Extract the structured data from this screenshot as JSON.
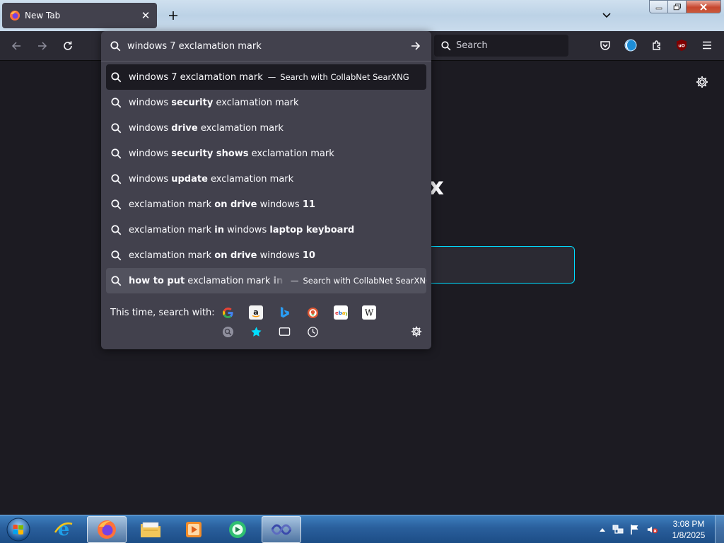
{
  "tab": {
    "title": "New Tab",
    "close": "✕",
    "icon": "firefox-icon"
  },
  "tabstrip": {
    "newtab_label": "+",
    "tablist_icon": "chevron-down-icon"
  },
  "window_controls": {
    "minimize": "minimize-icon",
    "maximize": "maximize-icon",
    "close": "close-icon"
  },
  "urlbar": {
    "value": "windows 7 exclamation mark",
    "results": [
      {
        "parts": [
          {
            "t": "windows 7 exclamation mark",
            "b": false
          }
        ],
        "action": "Search with CollabNet SearXNG",
        "state": "selected"
      },
      {
        "parts": [
          {
            "t": "windows ",
            "b": false
          },
          {
            "t": "security",
            "b": true
          },
          {
            "t": " exclamation mark",
            "b": false
          }
        ]
      },
      {
        "parts": [
          {
            "t": "windows ",
            "b": false
          },
          {
            "t": "drive",
            "b": true
          },
          {
            "t": " exclamation mark",
            "b": false
          }
        ]
      },
      {
        "parts": [
          {
            "t": "windows ",
            "b": false
          },
          {
            "t": "security shows",
            "b": true
          },
          {
            "t": " exclamation mark",
            "b": false
          }
        ]
      },
      {
        "parts": [
          {
            "t": "windows ",
            "b": false
          },
          {
            "t": "update",
            "b": true
          },
          {
            "t": " exclamation mark",
            "b": false
          }
        ]
      },
      {
        "parts": [
          {
            "t": "exclamation mark ",
            "b": false
          },
          {
            "t": "on drive",
            "b": true
          },
          {
            "t": " windows ",
            "b": false
          },
          {
            "t": "11",
            "b": true
          }
        ]
      },
      {
        "parts": [
          {
            "t": "exclamation mark ",
            "b": false
          },
          {
            "t": "in",
            "b": true
          },
          {
            "t": " windows ",
            "b": false
          },
          {
            "t": "laptop keyboard",
            "b": true
          }
        ]
      },
      {
        "parts": [
          {
            "t": "exclamation mark ",
            "b": false
          },
          {
            "t": "on drive",
            "b": true
          },
          {
            "t": " windows ",
            "b": false
          },
          {
            "t": "10",
            "b": true
          }
        ]
      },
      {
        "parts": [
          {
            "t": "how to put",
            "b": true
          },
          {
            "t": " exclamation mark ",
            "b": false
          },
          {
            "t": "in computer",
            "b": true
          }
        ],
        "action": "Search with CollabNet SearXNG",
        "state": "hovered",
        "truncated": true
      }
    ],
    "separator": "—",
    "oneoffs_label": "This time, search with:",
    "engines": [
      "google-icon",
      "amazon-icon",
      "bing-icon",
      "duckduckgo-icon",
      "ebay-icon",
      "wikipedia-icon",
      "searxng-icon",
      "bookmarks-star-icon",
      "tabs-icon",
      "history-icon"
    ]
  },
  "navbar": {
    "search_placeholder": "Search"
  },
  "page": {
    "brand_fragment": "x"
  },
  "taskbar": {
    "apps": [
      "internet-explorer-icon",
      "firefox-icon",
      "file-explorer-icon",
      "media-player-icon",
      "messenger-icon",
      "network-app-icon"
    ],
    "active_app": "firefox-icon",
    "clock_time": "3:08 PM",
    "clock_date": "1/8/2025"
  }
}
